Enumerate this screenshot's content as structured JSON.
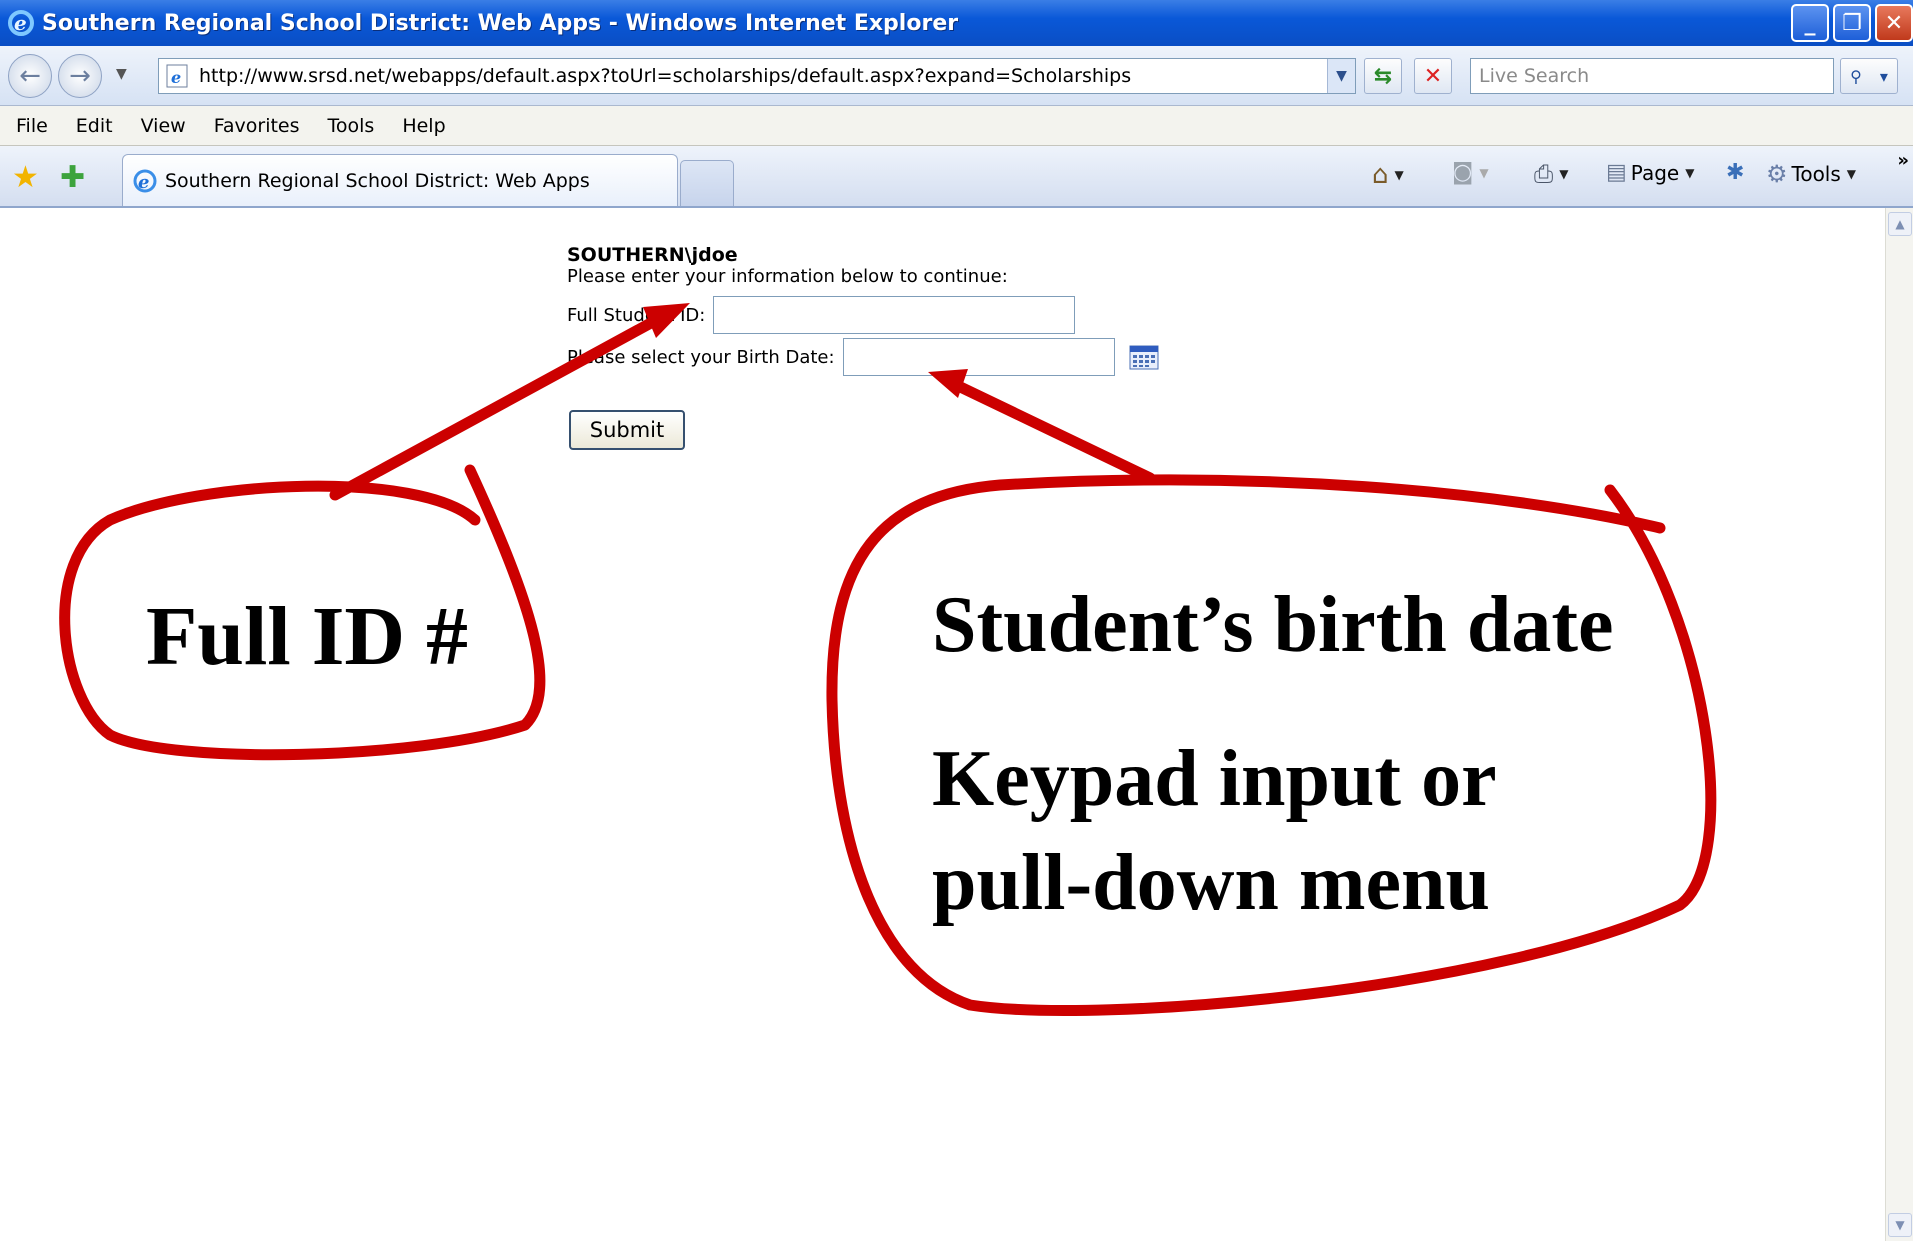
{
  "window": {
    "title": "Southern Regional School District: Web Apps - Windows Internet Explorer",
    "minimize_glyph": "_",
    "maximize_glyph": "❐",
    "close_glyph": "✕"
  },
  "address_bar": {
    "url": "http://www.srsd.net/webapps/default.aspx?toUrl=scholarships/default.aspx?expand=Scholarships",
    "search_placeholder": "Live Search",
    "refresh_glyph": "⇆",
    "stop_glyph": "✕",
    "search_glyph": "⚲"
  },
  "menu": {
    "items": [
      {
        "label": "File"
      },
      {
        "label": "Edit"
      },
      {
        "label": "View"
      },
      {
        "label": "Favorites"
      },
      {
        "label": "Tools"
      },
      {
        "label": "Help"
      }
    ]
  },
  "tabs": {
    "active_label": "Southern Regional School District: Web Apps"
  },
  "command_bar": {
    "page_label": "Page",
    "tools_label": "Tools",
    "overflow_glyph": "»"
  },
  "form": {
    "username": "SOUTHERN\\jdoe",
    "prompt": "Please enter your information below to continue:",
    "student_id_label": "Full Student ID:",
    "birth_date_label": "Please select your Birth Date:",
    "submit_label": "Submit",
    "student_id_value": "",
    "birth_date_value": ""
  },
  "annotations": {
    "left_bubble": "Full ID #",
    "right_bubble_line1": "Student’s birth date",
    "right_bubble_line2": "Keypad input or",
    "right_bubble_line3": "pull-down menu",
    "color": "#cc0000"
  }
}
